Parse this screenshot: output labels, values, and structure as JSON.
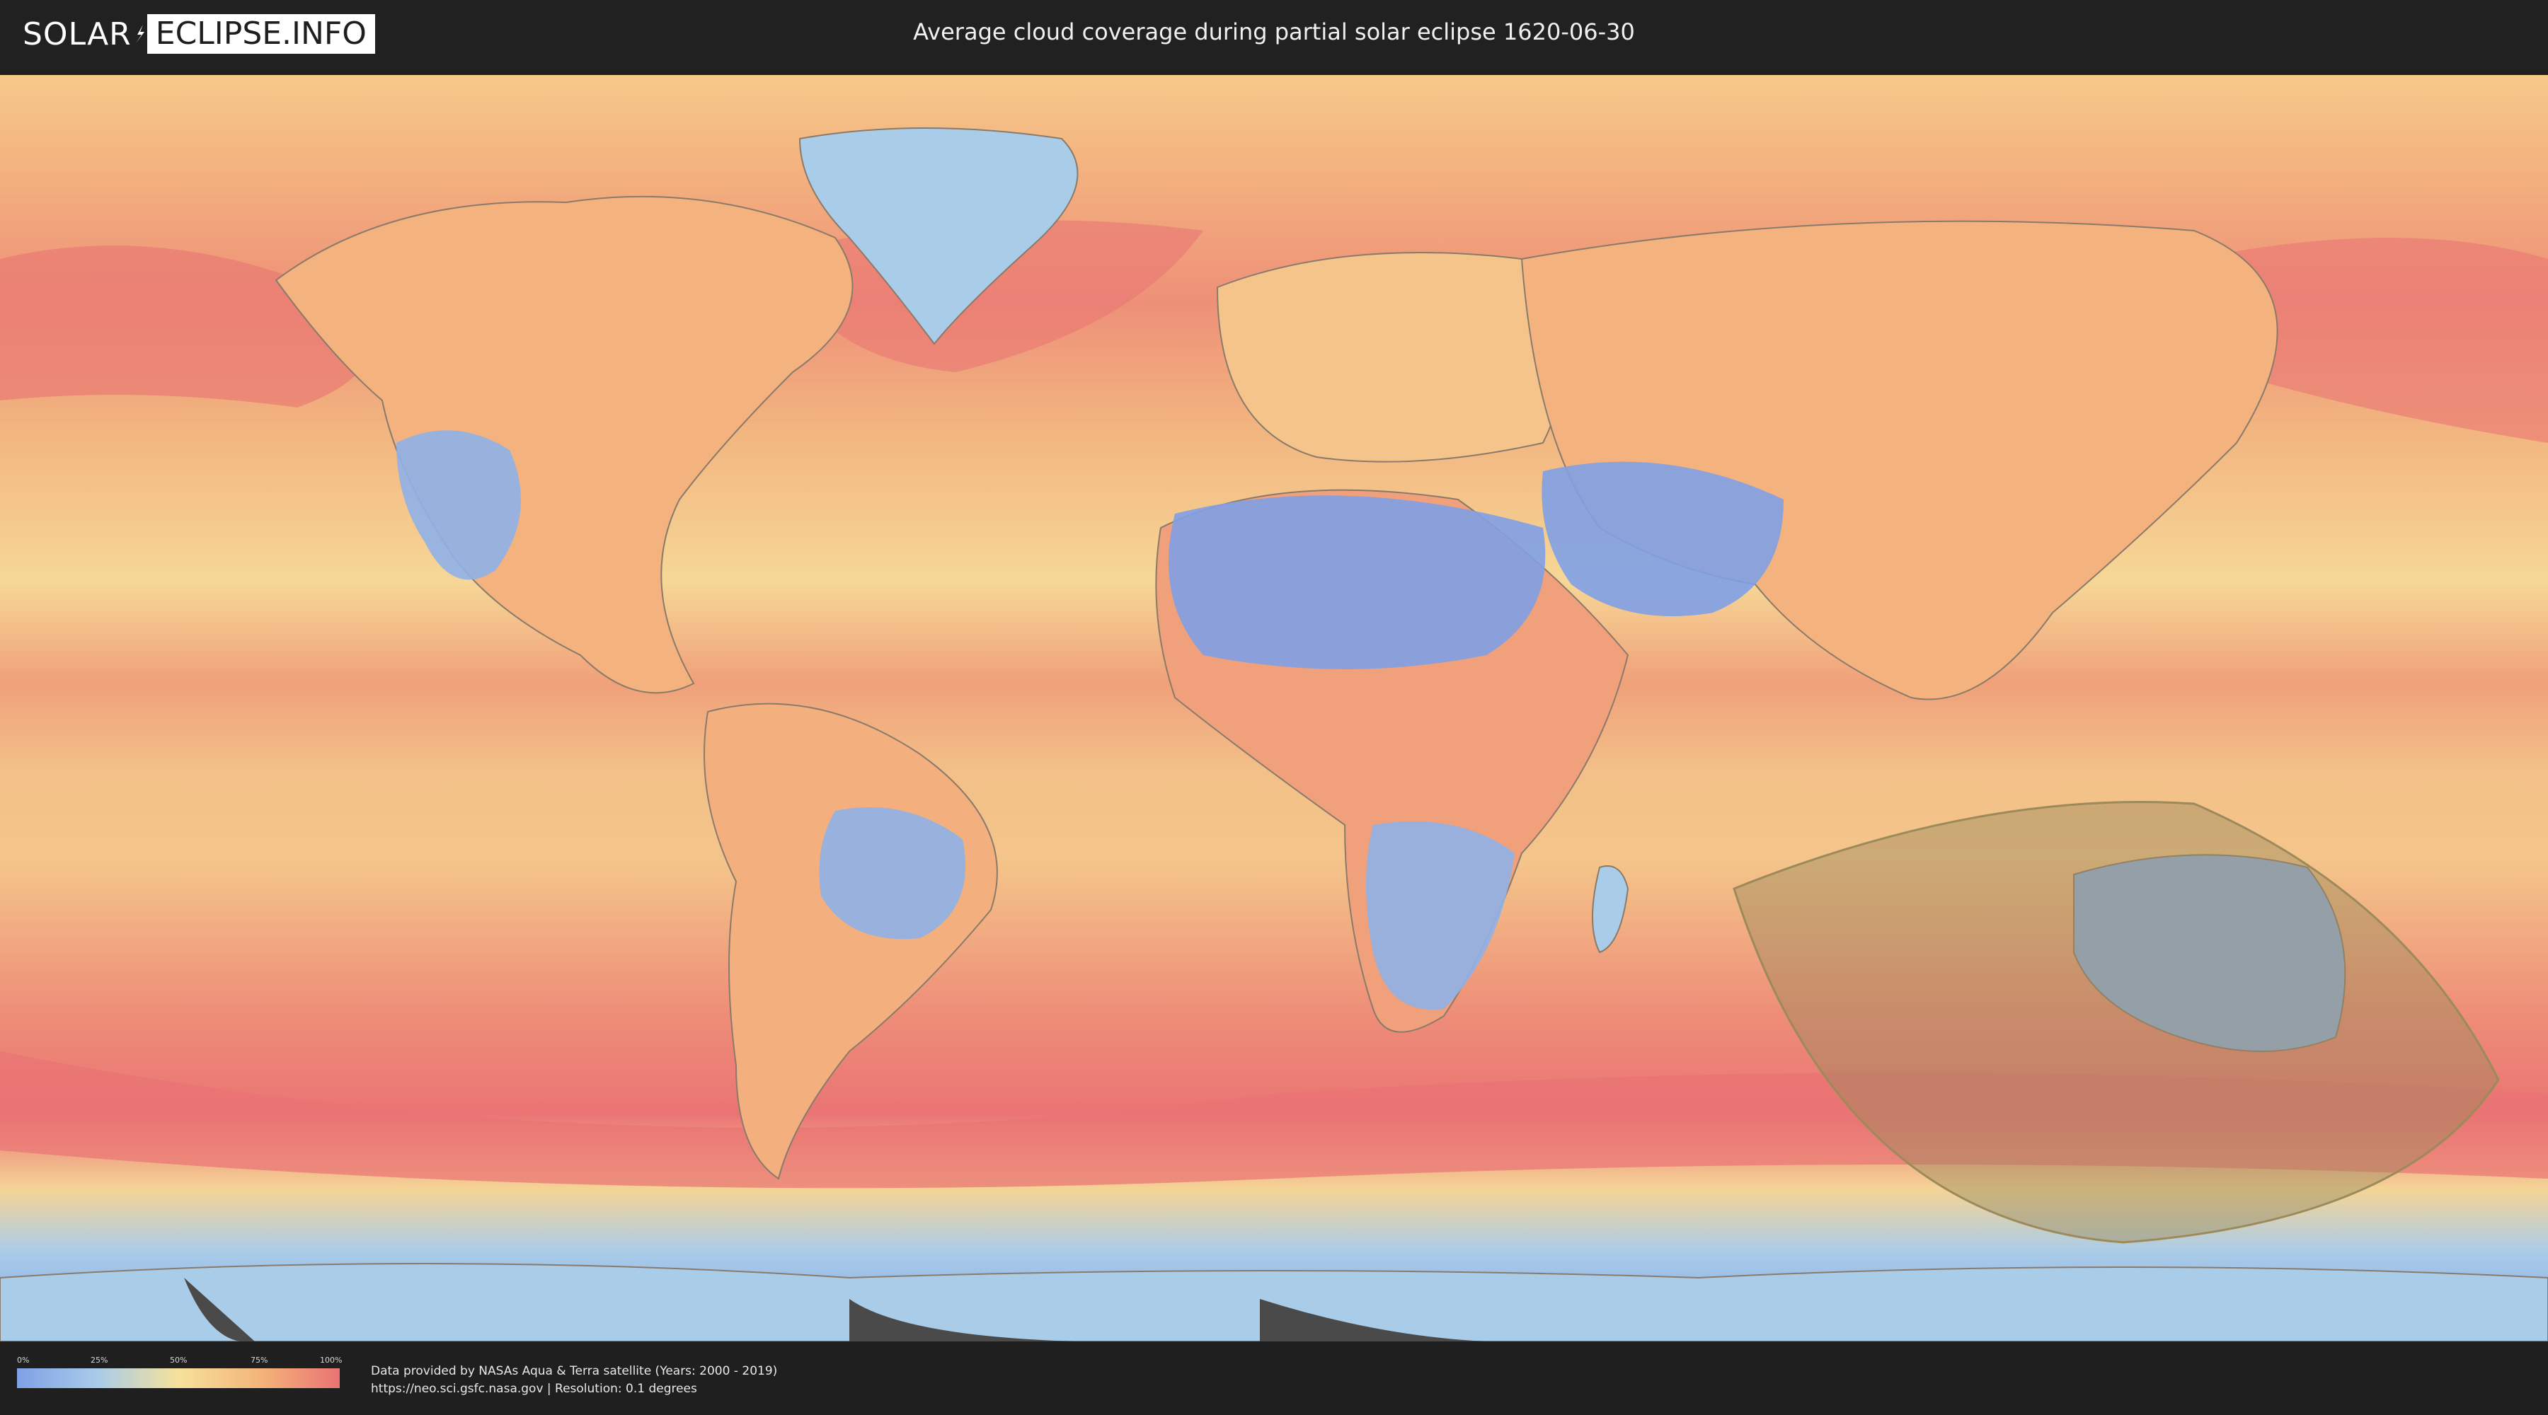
{
  "header": {
    "logo_left": "SOLAR",
    "logo_right": "ECLIPSE.INFO",
    "title": "Average cloud coverage during partial solar eclipse 1620-06-30"
  },
  "map": {
    "colors": {
      "clear": "#7fa0e6",
      "light": "#a9cce9",
      "medium": "#f6e19b",
      "heavy": "#f4b57a",
      "overcast": "#ea7474",
      "eclipse_zone": "#9c8a5a",
      "land_border": "#8a7a6a",
      "no_data": "#4a4a4a"
    },
    "eclipse_zone_icon": "shaded-eclipse-visibility-region"
  },
  "legend": {
    "ticks": [
      "0%",
      "25%",
      "50%",
      "75%",
      "100%"
    ]
  },
  "footer": {
    "line1": "Data provided by NASAs Aqua & Terra satellite (Years: 2000 - 2019)",
    "line2": "https://neo.sci.gsfc.nasa.gov | Resolution: 0.1 degrees"
  }
}
